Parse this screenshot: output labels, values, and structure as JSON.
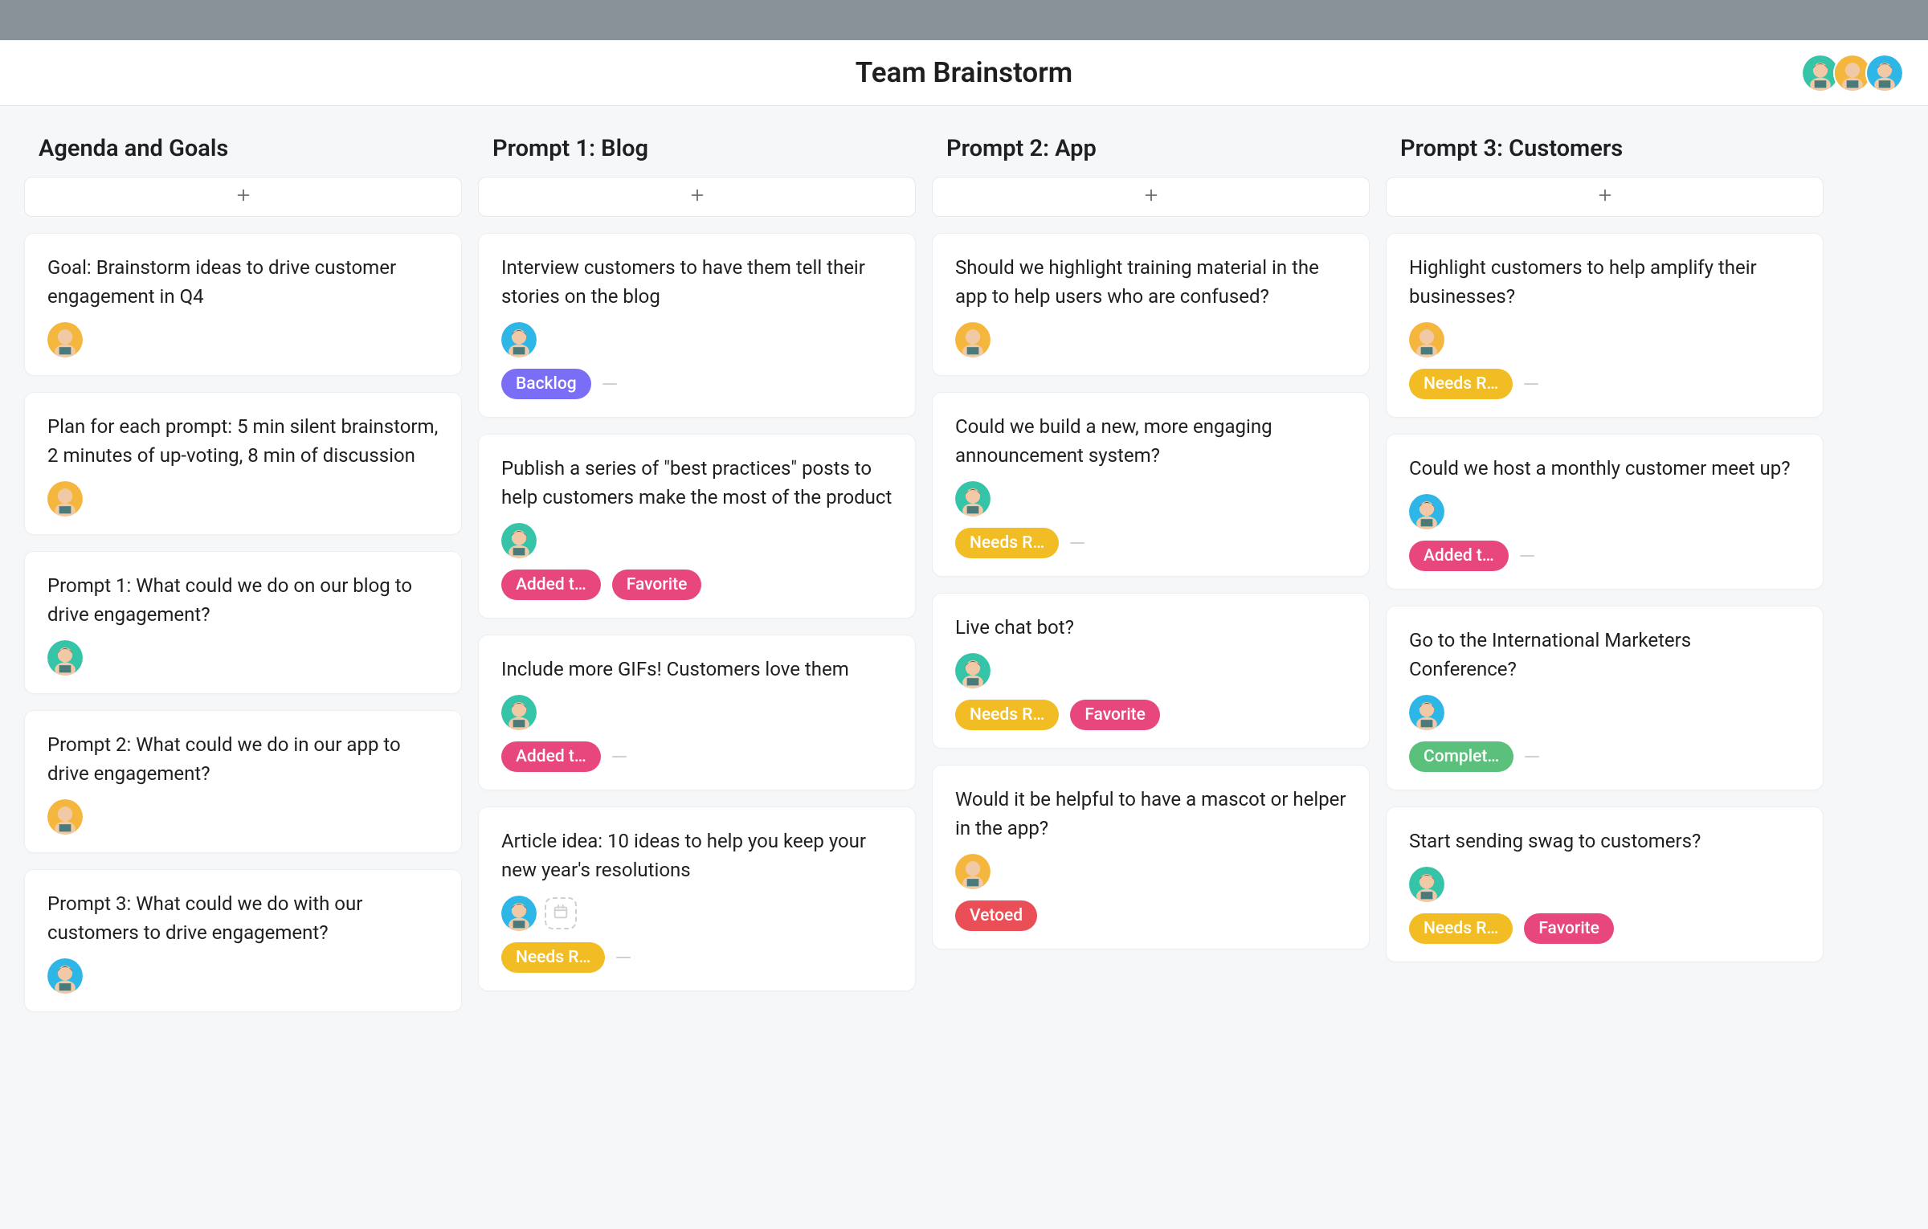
{
  "header": {
    "title": "Team Brainstorm",
    "members": [
      {
        "avatar": "teal"
      },
      {
        "avatar": "yellow"
      },
      {
        "avatar": "blue"
      }
    ]
  },
  "tag_colors": {
    "Backlog": "purple",
    "Added t…": "pink",
    "Favorite": "pink",
    "Needs R…": "yellow",
    "Vetoed": "red",
    "Complet…": "green"
  },
  "columns": [
    {
      "title": "Agenda and Goals",
      "cards": [
        {
          "text": "Goal: Brainstorm ideas to drive customer engagement in Q4",
          "avatar": "yellow"
        },
        {
          "text": "Plan for each prompt: 5 min silent brainstorm, 2 minutes of up-voting, 8 min of discussion",
          "avatar": "yellow"
        },
        {
          "text": "Prompt 1: What could we do on our blog to drive engagement?",
          "avatar": "teal"
        },
        {
          "text": "Prompt 2: What could we do in our app to drive engagement?",
          "avatar": "yellow"
        },
        {
          "text": "Prompt 3: What could we do with our customers to drive engagement?",
          "avatar": "blue"
        }
      ]
    },
    {
      "title": "Prompt 1: Blog",
      "cards": [
        {
          "text": "Interview customers to have them tell their stories on the blog",
          "avatar": "blue",
          "tags": [
            "Backlog"
          ],
          "trailing_dash": true
        },
        {
          "text": "Publish a series of \"best practices\" posts to help customers make the most of the product",
          "avatar": "teal",
          "tags": [
            "Added t…",
            "Favorite"
          ]
        },
        {
          "text": "Include more GIFs! Customers love them",
          "avatar": "teal",
          "tags": [
            "Added t…"
          ],
          "trailing_dash": true
        },
        {
          "text": "Article idea: 10 ideas to help you keep your new year's resolutions",
          "avatar": "blue",
          "date_chip": true,
          "tags": [
            "Needs R…"
          ],
          "trailing_dash": true
        }
      ]
    },
    {
      "title": "Prompt 2: App",
      "cards": [
        {
          "text": "Should we highlight training material in the app to help users who are confused?",
          "avatar": "yellow"
        },
        {
          "text": "Could we build a new, more engaging announcement system?",
          "avatar": "teal",
          "tags": [
            "Needs R…"
          ],
          "trailing_dash": true
        },
        {
          "text": "Live chat bot?",
          "avatar": "teal",
          "tags": [
            "Needs R…",
            "Favorite"
          ]
        },
        {
          "text": "Would it be helpful to have a mascot or helper in the app?",
          "avatar": "yellow",
          "tags": [
            "Vetoed"
          ]
        }
      ]
    },
    {
      "title": "Prompt 3: Customers",
      "cards": [
        {
          "text": "Highlight customers to help amplify their businesses?",
          "avatar": "yellow",
          "tags": [
            "Needs R…"
          ],
          "trailing_dash": true
        },
        {
          "text": "Could we host a monthly customer meet up?",
          "avatar": "blue",
          "tags": [
            "Added t…"
          ],
          "trailing_dash": true
        },
        {
          "text": "Go to the International Marketers Conference?",
          "avatar": "blue",
          "tags": [
            "Complet…"
          ],
          "trailing_dash": true
        },
        {
          "text": "Start sending swag to customers?",
          "avatar": "teal",
          "tags": [
            "Needs R…",
            "Favorite"
          ]
        }
      ]
    }
  ]
}
